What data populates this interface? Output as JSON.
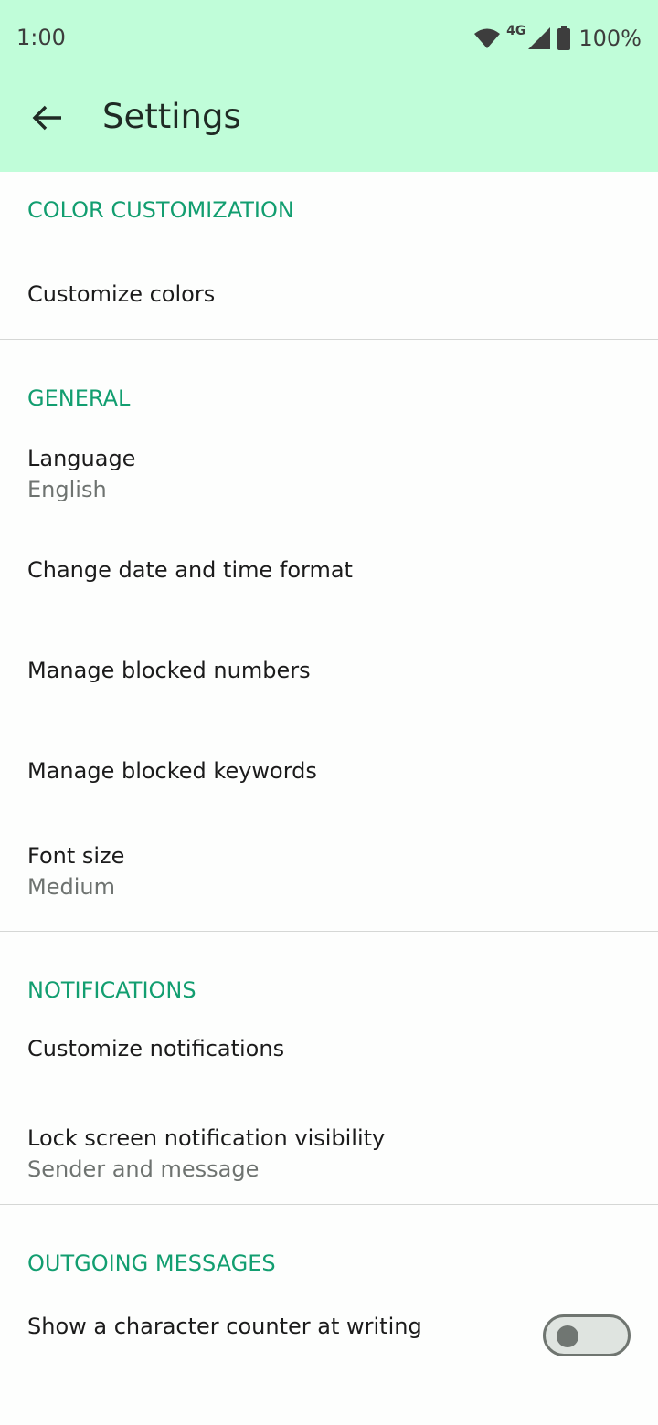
{
  "status_bar": {
    "time": "1:00",
    "network": "4G",
    "battery": "100%",
    "icons": [
      "wifi-icon",
      "cell-signal-icon",
      "battery-icon"
    ]
  },
  "app_bar": {
    "back_icon": "arrow-left-icon",
    "title": "Settings"
  },
  "sections": {
    "color": {
      "header": "COLOR CUSTOMIZATION",
      "items": [
        {
          "label": "Customize colors"
        }
      ]
    },
    "general": {
      "header": "GENERAL",
      "items": [
        {
          "label": "Language",
          "value": "English"
        },
        {
          "label": "Change date and time format"
        },
        {
          "label": "Manage blocked numbers"
        },
        {
          "label": "Manage blocked keywords"
        },
        {
          "label": "Font size",
          "value": "Medium"
        }
      ]
    },
    "notifications": {
      "header": "NOTIFICATIONS",
      "items": [
        {
          "label": "Customize notifications"
        },
        {
          "label": "Lock screen notification visibility",
          "value": "Sender and message"
        }
      ]
    },
    "outgoing": {
      "header": "OUTGOING MESSAGES",
      "items": [
        {
          "label": "Show a character counter at writing",
          "toggle": "off"
        }
      ]
    }
  },
  "colors": {
    "app_bar": "#c0fdd9",
    "accent": "#129e70",
    "background": "#fdfefd"
  }
}
